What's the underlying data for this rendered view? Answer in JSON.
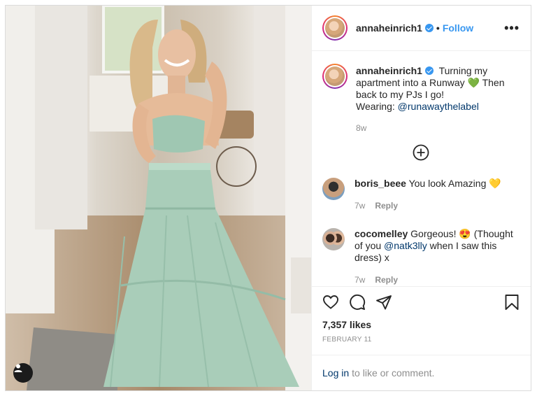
{
  "post": {
    "username": "annaheinrich1",
    "follow_label": "Follow",
    "separator": "•",
    "more_label": "•••"
  },
  "caption": {
    "username": "annaheinrich1",
    "text": "Turning my apartment into a Runway 💚 Then back to my PJs I go!",
    "wearing_label": "Wearing:",
    "wearing_mention": "@runawaythelabel",
    "time": "8w"
  },
  "comments": [
    {
      "username": "boris_beee",
      "text": "You look Amazing 💛",
      "time": "7w",
      "reply_label": "Reply"
    },
    {
      "username": "cocomelley",
      "text_before": "Gorgeous! 😍 (Thought of you",
      "mention": "@natk3lly",
      "text_after": "when I saw this dress) x",
      "time": "7w",
      "reply_label": "Reply"
    }
  ],
  "stats": {
    "likes": "7,357 likes",
    "date": "FEBRUARY 11"
  },
  "login": {
    "link": "Log in",
    "rest": "to like or comment."
  },
  "icons": {
    "like": "heart-icon",
    "comment": "comment-icon",
    "share": "share-icon",
    "save": "bookmark-icon",
    "add": "plus-circle-icon",
    "user_tag": "user-tag-icon"
  },
  "colors": {
    "accent": "#3897f0",
    "mention": "#00376b",
    "muted": "#8e8e8e",
    "dress": "#a9cdb9"
  }
}
